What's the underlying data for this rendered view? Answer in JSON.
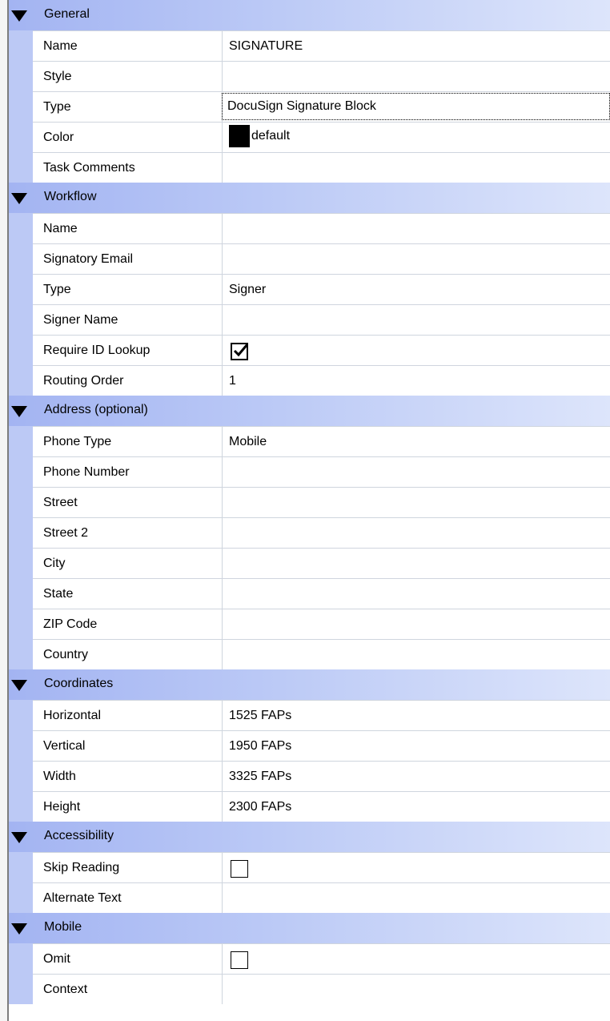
{
  "colors": {
    "header_start": "#a3b4f2",
    "header_end": "#dde5fb",
    "gutter": "#bcc9f5",
    "row_border": "#cfd5de",
    "swatch": "#000000"
  },
  "icons": {
    "expand": "triangle-down-icon",
    "checkmark": "checkmark-icon"
  },
  "categories": [
    {
      "label": "General",
      "rows": [
        {
          "name": "Name",
          "value": "SIGNATURE"
        },
        {
          "name": "Style",
          "value": ""
        },
        {
          "name": "Type",
          "value": "DocuSign Signature Block",
          "selected": true
        },
        {
          "name": "Color",
          "value": "default",
          "swatch": "#000000"
        },
        {
          "name": "Task Comments",
          "value": ""
        }
      ]
    },
    {
      "label": "Workflow",
      "rows": [
        {
          "name": "Name",
          "value": ""
        },
        {
          "name": "Signatory Email",
          "value": ""
        },
        {
          "name": "Type",
          "value": "Signer"
        },
        {
          "name": "Signer Name",
          "value": ""
        },
        {
          "name": "Require ID Lookup",
          "checkbox": true,
          "checked": true
        },
        {
          "name": "Routing Order",
          "value": "1"
        }
      ]
    },
    {
      "label": "Address (optional)",
      "rows": [
        {
          "name": "Phone Type",
          "value": "Mobile"
        },
        {
          "name": "Phone Number",
          "value": ""
        },
        {
          "name": "Street",
          "value": ""
        },
        {
          "name": "Street 2",
          "value": ""
        },
        {
          "name": "City",
          "value": ""
        },
        {
          "name": "State",
          "value": ""
        },
        {
          "name": "ZIP Code",
          "value": ""
        },
        {
          "name": "Country",
          "value": ""
        }
      ]
    },
    {
      "label": "Coordinates",
      "rows": [
        {
          "name": "Horizontal",
          "value": "1525 FAPs"
        },
        {
          "name": "Vertical",
          "value": "1950 FAPs"
        },
        {
          "name": "Width",
          "value": "3325 FAPs"
        },
        {
          "name": "Height",
          "value": "2300 FAPs"
        }
      ]
    },
    {
      "label": "Accessibility",
      "rows": [
        {
          "name": "Skip Reading",
          "checkbox": true,
          "checked": false
        },
        {
          "name": "Alternate Text",
          "value": ""
        }
      ]
    },
    {
      "label": "Mobile",
      "rows": [
        {
          "name": "Omit",
          "checkbox": true,
          "checked": false
        },
        {
          "name": "Context",
          "value": ""
        }
      ]
    }
  ]
}
